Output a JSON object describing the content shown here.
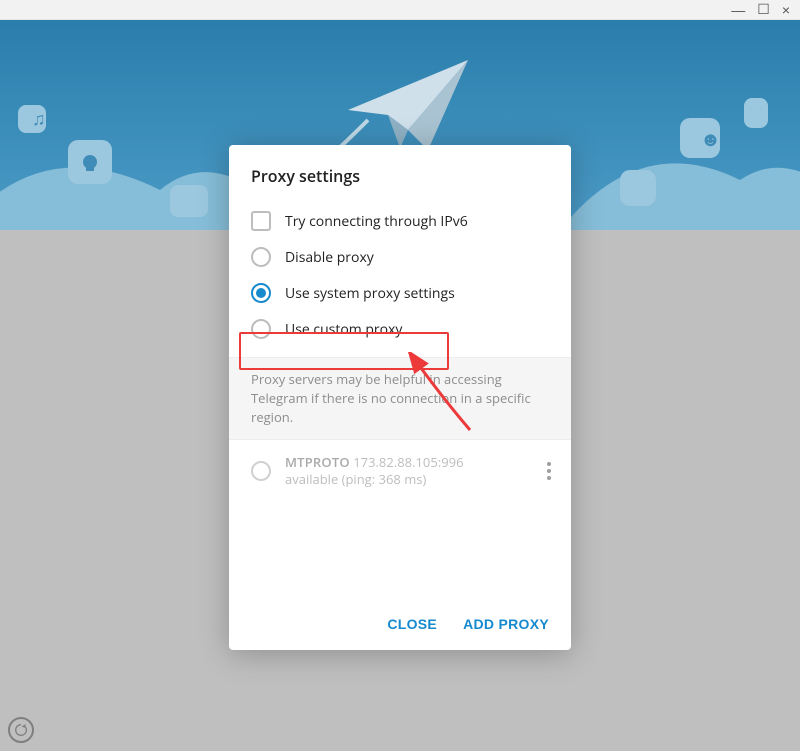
{
  "window": {
    "minimize": "—",
    "maximize": "☐",
    "close": "×"
  },
  "modal": {
    "title": "Proxy settings",
    "options": {
      "ipv6": "Try connecting through IPv6",
      "disable": "Disable proxy",
      "system": "Use system proxy settings",
      "custom": "Use custom proxy"
    },
    "selected": "system",
    "info": "Proxy servers may be helpful in accessing Telegram if there is no connection in a specific region.",
    "proxy": {
      "protocol": "MTPROTO",
      "address": "173.82.88.105:996",
      "status": "available (ping: 368 ms)"
    },
    "actions": {
      "close": "CLOSE",
      "add": "ADD PROXY"
    }
  }
}
